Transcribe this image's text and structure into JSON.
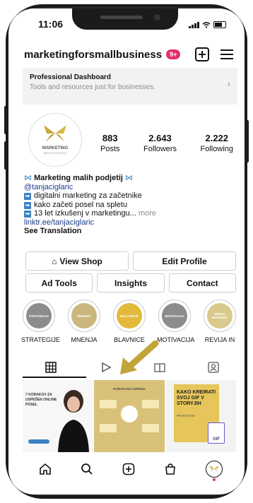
{
  "status_bar": {
    "time": "11:06"
  },
  "header": {
    "username": "marketingforsmallbusiness",
    "notif_badge": "9+"
  },
  "dashboard": {
    "title": "Professional Dashboard",
    "subtitle": "Tools and resources just for businesses."
  },
  "profile": {
    "logo_text": "MARKETING",
    "logo_sub": "MALIH PODJETIJ",
    "stats": [
      {
        "value": "883",
        "label": "Posts"
      },
      {
        "value": "2.643",
        "label": "Followers"
      },
      {
        "value": "2.222",
        "label": "Following"
      }
    ]
  },
  "bio": {
    "name": "Marketing malih podjetij",
    "handle": "@tanjaciglaric",
    "lines": [
      "digitalni marketing za začetnike",
      "kako začeti posel na spletu",
      "13 let izkušenj v marketingu..."
    ],
    "more": "more",
    "link": "linktr.ee/tanjaciglaric",
    "translation": "See Translation"
  },
  "buttons": {
    "view_shop": "View Shop",
    "edit_profile": "Edit Profile",
    "ad_tools": "Ad Tools",
    "insights": "Insights",
    "contact": "Contact"
  },
  "highlights": [
    {
      "label": "STRATEGIJE",
      "circle_text": "STRATEGIJA",
      "color": "#8c8c8c"
    },
    {
      "label": "MNENJA",
      "circle_text": "MNENJA",
      "color": "#c9b77e"
    },
    {
      "label": "BLAVNICE",
      "circle_text": "BELAVNICE",
      "color": "#e2b93a"
    },
    {
      "label": "MOTIVACIJA",
      "circle_text": "MOTIVACIJA",
      "color": "#8c8c8c"
    },
    {
      "label": "REVIJA IN",
      "circle_text": "REVIJA INTERNET",
      "color": "#d9c98a"
    }
  ],
  "posts": [
    {
      "title": "7 KORAKOV ZA USPEŠEN ONLINE POSEL"
    },
    {
      "title": "KORAKI DO USPEHA"
    },
    {
      "title": "KAKO KREIRATI SVOJ GIF V STORYJIH",
      "subtitle": "PRAKTIČNO",
      "file_label": "GIF"
    }
  ],
  "colors": {
    "accent": "#e1306c",
    "link": "#1a3a8a",
    "gold": "#c9a93a"
  }
}
